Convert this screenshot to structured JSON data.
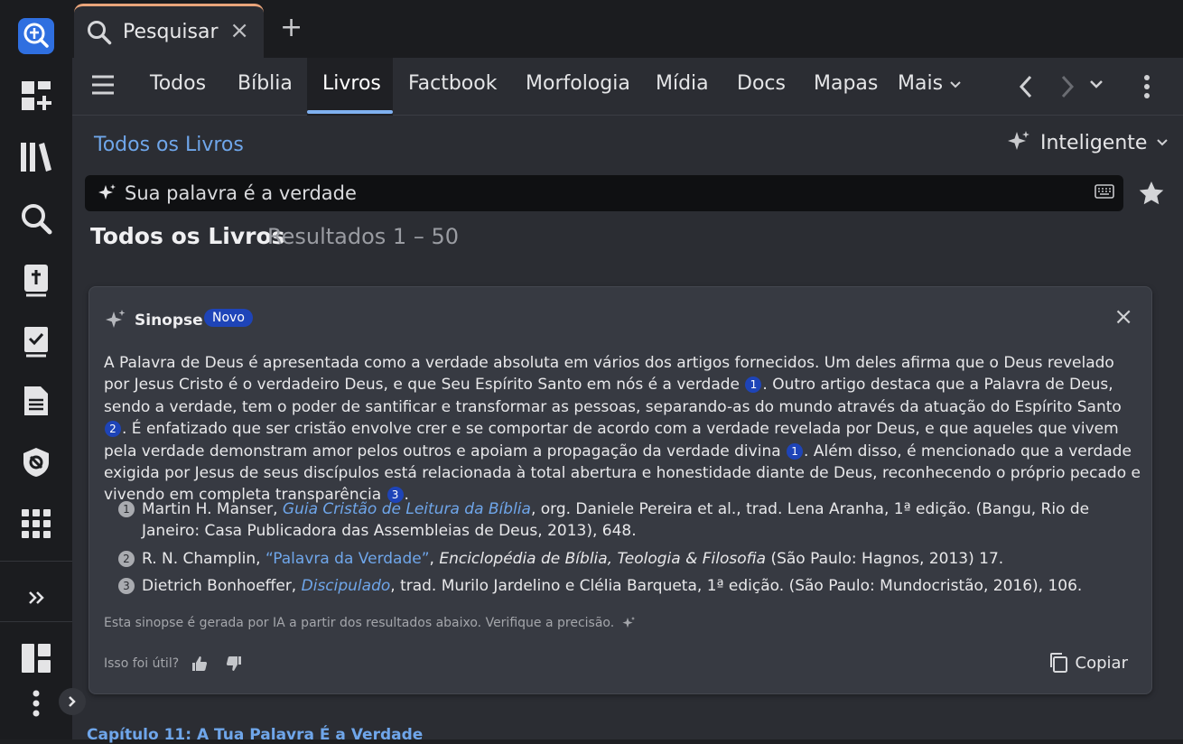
{
  "tabs": {
    "active_label": "Pesquisar",
    "close": "×",
    "add": "+"
  },
  "nav": {
    "items": [
      "Todos",
      "Bíblia",
      "Livros",
      "Factbook",
      "Morfologia",
      "Mídia",
      "Docs",
      "Mapas"
    ],
    "more": "Mais",
    "active": "Livros"
  },
  "breadcrumb": "Todos os Livros",
  "mode": {
    "label": "Inteligente"
  },
  "search": {
    "value": "Sua palavra é a verdade"
  },
  "results": {
    "title": "Todos os Livros",
    "range": "Resultados 1 – 50"
  },
  "synopsis": {
    "title": "Sinopse",
    "badge": "Novo",
    "close": "×",
    "p1": "A Palavra de Deus é apresentada como a verdade absoluta em vários dos artigos fornecidos. Um deles afirma que o Deus revelado por Jesus Cristo é o verdadeiro Deus, e que Seu Espírito Santo em nós é a verdade",
    "p2": ". Outro artigo destaca que a Palavra de Deus, sendo a verdade, tem o poder de santificar e transformar as pessoas, separando-as do mundo através da atuação do Espírito Santo",
    "p3": ". É enfatizado que ser cristão envolve crer e se comportar de acordo com a verdade revelada por Deus, e que aqueles que vivem pela verdade demonstram amor pelos outros e apoiam a propagação da verdade divina",
    "p4": ". Além disso, é mencionado que a verdade exigida por Jesus de seus discípulos está relacionada à total abertura e honestidade diante de Deus, reconhecendo o próprio pecado e vivendo em completa transparência",
    "p5": ".",
    "c1": "1",
    "c2": "2",
    "c3": "1",
    "c4": "3",
    "refs": [
      {
        "num": "1",
        "author": "Martin H. Manser, ",
        "title": "Guia Cristão de Leitura da Bíblia",
        "rest": ", org. Daniele Pereira et al., trad. Lena Aranha, 1ª edição. (Bangu, Rio de Janeiro: Casa Publicadora das Assembleias de Deus, 2013), 648."
      },
      {
        "num": "2",
        "author": "R. N. Champlin, ",
        "title": "“Palavra da Verdade”",
        "mid": ", ",
        "work": "Enciclopédia de Bíblia, Teologia & Filosofia",
        "rest": " (São Paulo: Hagnos, 2013) 17."
      },
      {
        "num": "3",
        "author": "Dietrich Bonhoeffer, ",
        "title": "Discipulado",
        "rest": ", trad. Murilo Jardelino e Clélia Barqueta, 1ª edição. (São Paulo: Mundocristão, 2016), 106."
      }
    ],
    "disclaimer": "Esta sinopse é gerada por IA a partir dos resultados abaixo. Verifique a precisão.",
    "feedback": "Isso foi útil?",
    "copy": "Copiar"
  },
  "next_result": "Capítulo 11: A Tua Palavra É a Verdade",
  "colors": {
    "accent": "#6fa6ea",
    "badge": "#1e44b8",
    "tab_highlight": "#e9a47a"
  }
}
